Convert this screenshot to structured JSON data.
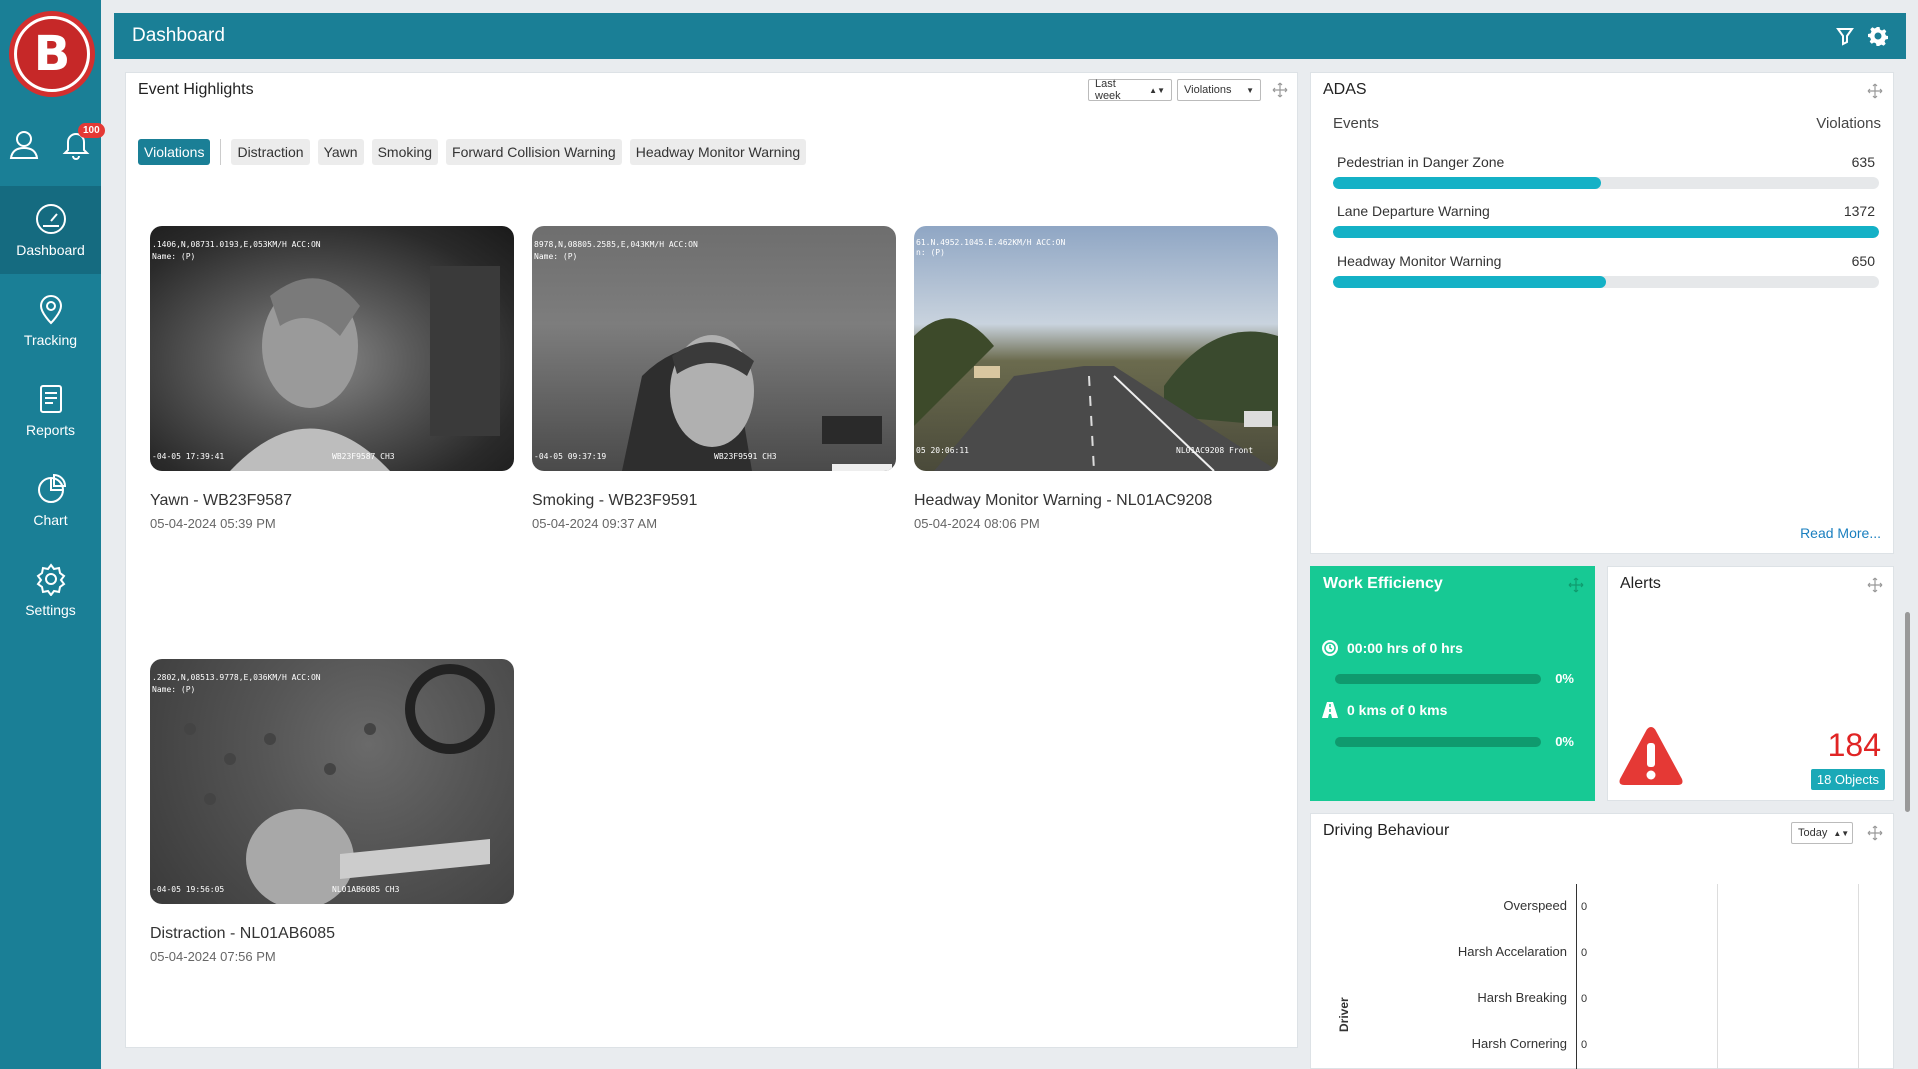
{
  "sidebar": {
    "notification_count": "100",
    "items": [
      {
        "label": "Dashboard",
        "icon": "dashboard-icon",
        "active": true
      },
      {
        "label": "Tracking",
        "icon": "location-pin-icon"
      },
      {
        "label": "Reports",
        "icon": "document-icon"
      },
      {
        "label": "Chart",
        "icon": "pie-chart-icon"
      },
      {
        "label": "Settings",
        "icon": "gear-icon"
      }
    ]
  },
  "header": {
    "title": "Dashboard"
  },
  "event_highlights": {
    "title": "Event Highlights",
    "period_select": "Last week",
    "type_select": "Violations",
    "chips": [
      "Violations",
      "Distraction",
      "Yawn",
      "Smoking",
      "Forward Collision Warning",
      "Headway Monitor Warning"
    ],
    "cards": [
      {
        "title": "Yawn - WB23F9587",
        "date": "05-04-2024 05:39 PM",
        "osd_top": ".1406,N,08731.0193,E,053KM/H ACC:ON",
        "osd_top2": "Name: (P)",
        "osd_bl": "-04-05 17:39:41",
        "osd_br": "WB23F9587 CH3"
      },
      {
        "title": "Smoking - WB23F9591",
        "date": "05-04-2024 09:37 AM",
        "osd_top": "8978,N,08805.2585,E,043KM/H ACC:ON",
        "osd_top2": "Name: (P)",
        "osd_bl": "-04-05 09:37:19",
        "osd_br": "WB23F9591 CH3"
      },
      {
        "title": "Headway Monitor Warning - NL01AC9208",
        "date": "05-04-2024 08:06 PM",
        "osd_top": "61.N.4952.1045.E.462KM/H ACC:ON",
        "osd_top2": "n: (P)",
        "osd_bl": "05 20:06:11",
        "osd_br": "NL01AC9208 Front"
      },
      {
        "title": "Distraction - NL01AB6085",
        "date": "05-04-2024 07:56 PM",
        "osd_top": ".2802,N,08513.9778,E,036KM/H ACC:ON",
        "osd_top2": "Name: (P)",
        "osd_bl": "-04-05 19:56:05",
        "osd_br": "NL01AB6085 CH3"
      }
    ]
  },
  "adas": {
    "title": "ADAS",
    "col_events": "Events",
    "col_violations": "Violations",
    "rows": [
      {
        "label": "Pedestrian in Danger Zone",
        "value": "635",
        "fraction": 0.49
      },
      {
        "label": "Lane Departure Warning",
        "value": "1372",
        "fraction": 1.0
      },
      {
        "label": "Headway Monitor Warning",
        "value": "650",
        "fraction": 0.5
      }
    ],
    "read_more": "Read More..."
  },
  "work_efficiency": {
    "title": "Work Efficiency",
    "hours": "00:00 hrs of 0 hrs",
    "hours_pct": "0%",
    "kms": "0 kms of 0 kms",
    "kms_pct": "0%"
  },
  "alerts": {
    "title": "Alerts",
    "count": "184",
    "objects": "18 Objects"
  },
  "driving_behaviour": {
    "title": "Driving Behaviour",
    "period_select": "Today",
    "axis_label": "Driver",
    "rows": [
      {
        "label": "Overspeed",
        "value": "0"
      },
      {
        "label": "Harsh Accelaration",
        "value": "0"
      },
      {
        "label": "Harsh Breaking",
        "value": "0"
      },
      {
        "label": "Harsh Cornering",
        "value": "0"
      }
    ]
  }
}
